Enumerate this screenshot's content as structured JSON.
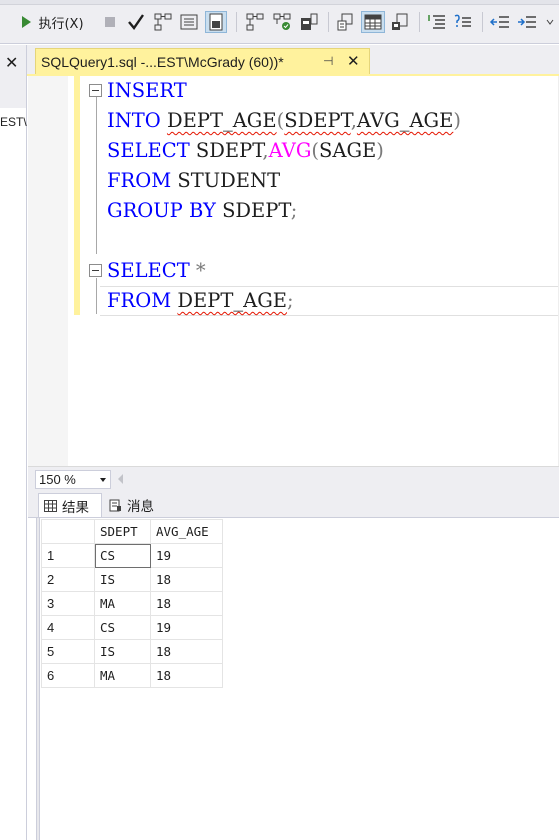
{
  "toolbar": {
    "execute_label": "执行(X)",
    "items": [
      "play-icon",
      "stop-icon",
      "parse-check-icon",
      "estimated-plan-icon",
      "display-results-icon",
      "query-options-icon",
      "actual-plan-icon",
      "live-stats-icon",
      "client-stats-icon",
      "results-text-icon",
      "results-grid-icon",
      "results-file-icon",
      "comment-icon",
      "uncomment-icon",
      "decrease-indent-icon",
      "increase-indent-icon"
    ]
  },
  "left_panel": {
    "close_glyph": "✕",
    "fragment": "EST\\"
  },
  "editor_tab": {
    "title": "SQLQuery1.sql -...EST\\McGrady (60))*",
    "pin_glyph": "⊣",
    "close_glyph": "✕"
  },
  "code": {
    "line1": {
      "kw": "INSERT"
    },
    "line2": {
      "kw": "INTO",
      "table": "DEPT_AGE",
      "open": "(",
      "col1": "SDEPT",
      "comma": ",",
      "col2": "AVG_AGE",
      "close": ")"
    },
    "line3": {
      "kw": "SELECT",
      "col": "SDEPT",
      "comma": ",",
      "fn": "AVG",
      "open": "(",
      "arg": "SAGE",
      "close": ")"
    },
    "line4": {
      "kw": "FROM",
      "table": "STUDENT"
    },
    "line5": {
      "kw": "GROUP BY",
      "col": "SDEPT",
      "semi": ";"
    },
    "line7": {
      "kw": "SELECT",
      "star": "*"
    },
    "line8": {
      "kw": "FROM",
      "table": "DEPT_AGE",
      "semi": ";"
    }
  },
  "zoom": {
    "value": "150 %"
  },
  "result_tabs": {
    "results": "结果",
    "messages": "消息"
  },
  "grid": {
    "columns": [
      "SDEPT",
      "AVG_AGE"
    ],
    "rows": [
      {
        "n": "1",
        "sdept": "CS",
        "avg_age": "19"
      },
      {
        "n": "2",
        "sdept": "IS",
        "avg_age": "18"
      },
      {
        "n": "3",
        "sdept": "MA",
        "avg_age": "18"
      },
      {
        "n": "4",
        "sdept": "CS",
        "avg_age": "19"
      },
      {
        "n": "5",
        "sdept": "IS",
        "avg_age": "18"
      },
      {
        "n": "6",
        "sdept": "MA",
        "avg_age": "18"
      }
    ]
  },
  "colors": {
    "keyword": "#0000ff",
    "function": "#ff00ff",
    "tab_active": "#fff29d",
    "squiggle": "#e51400"
  }
}
